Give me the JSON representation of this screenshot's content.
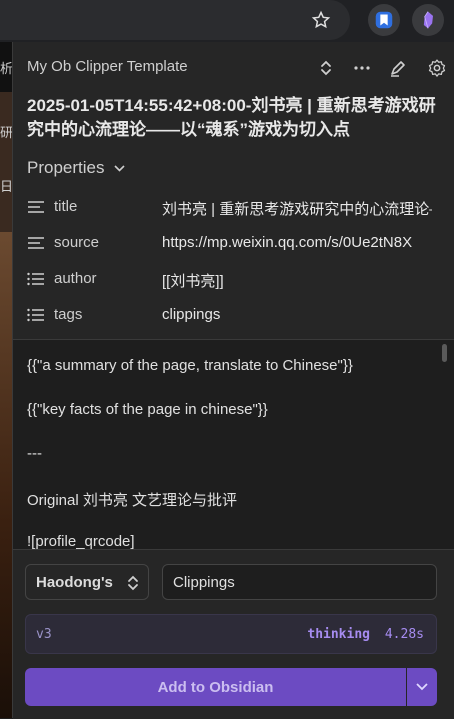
{
  "browser": {
    "star_icon": "star-icon",
    "extensions": [
      "bookmark-extension-icon",
      "obsidian-icon"
    ]
  },
  "behind_page": {
    "glyphs": [
      "析",
      "研",
      "日"
    ]
  },
  "popup": {
    "template_name": "My Ob Clipper Template",
    "note_title": "2025-01-05T14:55:42+08:00-刘书亮 | 重新思考游戏研究中的心流理论——以“魂系”游戏为切入点",
    "properties_label": "Properties",
    "properties": [
      {
        "icon": "text-icon",
        "key": "title",
        "value": "刘书亮 | 重新思考游戏研究中的心流理论——以“魂系”游戏为切入点"
      },
      {
        "icon": "text-icon",
        "key": "source",
        "value": "https://mp.weixin.qq.com/s/0Ue2tN8X"
      },
      {
        "icon": "list-icon",
        "key": "author",
        "value": "[[刘书亮]]"
      },
      {
        "icon": "list-icon",
        "key": "tags",
        "value": "clippings"
      }
    ],
    "body_lines": [
      "{{\"a summary of the page, translate to Chinese\"}}",
      "{{\"key facts of the page in chinese\"}}",
      "---",
      "Original 刘书亮 文艺理论与批评",
      "![profile_qrcode]"
    ],
    "vault_select": "Haodong's",
    "folder_value": "Clippings",
    "status": {
      "version": "v3",
      "state": "thinking",
      "time": "4.28s"
    },
    "add_button": "Add to Obsidian"
  },
  "colors": {
    "accent": "#6c4bc2",
    "background": "#262626"
  }
}
